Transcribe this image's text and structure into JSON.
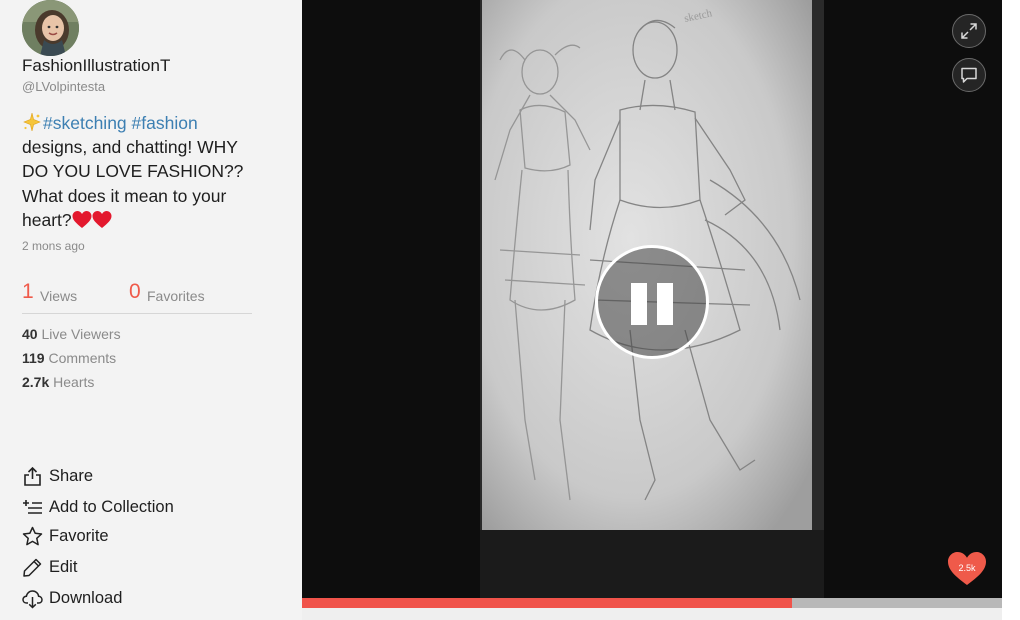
{
  "user": {
    "display_name": "FashionIllustrationT",
    "handle": "@LVolpintesta"
  },
  "post": {
    "hashtag_1": "#sketching",
    "hashtag_2": "#fashion",
    "caption_body": "designs, and chatting! WHY DO YOU LOVE FASHION?? What does it mean to your heart?",
    "caption_emojis": [
      "sparkle-icon",
      "red-heart-icon",
      "red-heart-icon"
    ],
    "posted": "2 mons ago"
  },
  "stats": {
    "views_count": "1",
    "views_label": "Views",
    "favorites_count": "0",
    "favorites_label": "Favorites"
  },
  "metrics": {
    "live_viewers_value": "40",
    "live_viewers_label": "Live Viewers",
    "comments_value": "119",
    "comments_label": "Comments",
    "hearts_value": "2.7k",
    "hearts_label": "Hearts"
  },
  "actions": {
    "share": "Share",
    "add_to_collection": "Add to Collection",
    "favorite": "Favorite",
    "edit": "Edit",
    "download": "Download"
  },
  "player": {
    "state": "playing",
    "hearts_badge": "2.5k",
    "progress_fraction": 0.7
  },
  "colors": {
    "accent": "#ef5a4a",
    "hashtag": "#3c7fb2",
    "progress_fill": "#f0534a",
    "progress_track": "#b8b8b8"
  }
}
